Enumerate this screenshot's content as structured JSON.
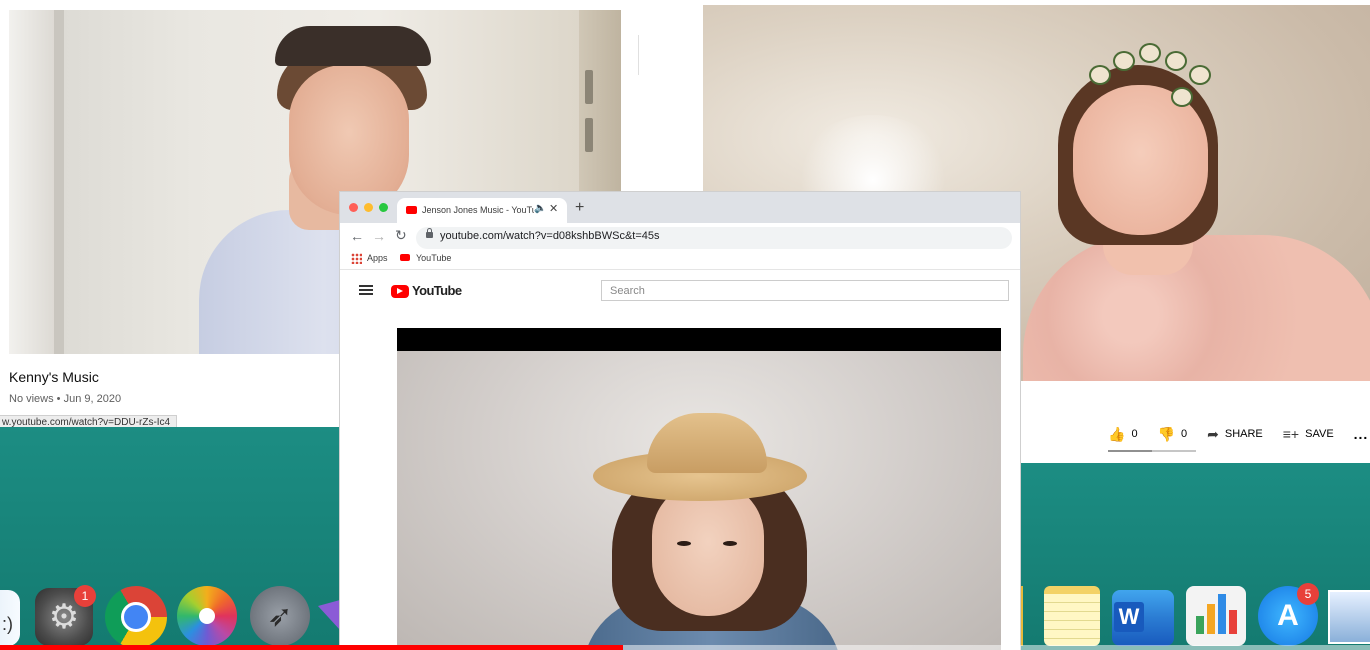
{
  "left_video": {
    "title": "Kenny's Music",
    "meta": "No views • Jun 9, 2020",
    "status_url": "w.youtube.com/watch?v=DDU-rZs-Ic4"
  },
  "right_video": {
    "actions": {
      "like_count": "0",
      "dislike_count": "0",
      "share_label": "SHARE",
      "save_label": "SAVE",
      "more_label": "..."
    }
  },
  "browser": {
    "tab_title": "Jenson Jones Music - YouTube",
    "new_tab_label": "+",
    "url": "youtube.com/watch?v=d08kshbBWSc&t=45s",
    "bookmarks": [
      {
        "label": "Apps",
        "icon": "apps-grid-icon"
      },
      {
        "label": "YouTube",
        "icon": "youtube-icon"
      }
    ],
    "youtube": {
      "logo_text": "YouTube",
      "search_placeholder": "Search"
    }
  },
  "dock": {
    "settings_badge": "1",
    "appstore_badge": "5",
    "word_letter": "W",
    "icons": [
      "finder-icon",
      "system-preferences-icon",
      "chrome-icon",
      "photos-icon",
      "launchpad-icon",
      "notes-icon",
      "word-icon",
      "numbers-icon",
      "app-store-icon",
      "preview-icon"
    ]
  },
  "playback": {
    "progress_fraction": 0.455
  },
  "colors": {
    "teal_desktop": "#178a80",
    "youtube_red": "#ff0000",
    "chrome_tabstrip": "#dee1e6",
    "badge_red": "#e8403a"
  }
}
